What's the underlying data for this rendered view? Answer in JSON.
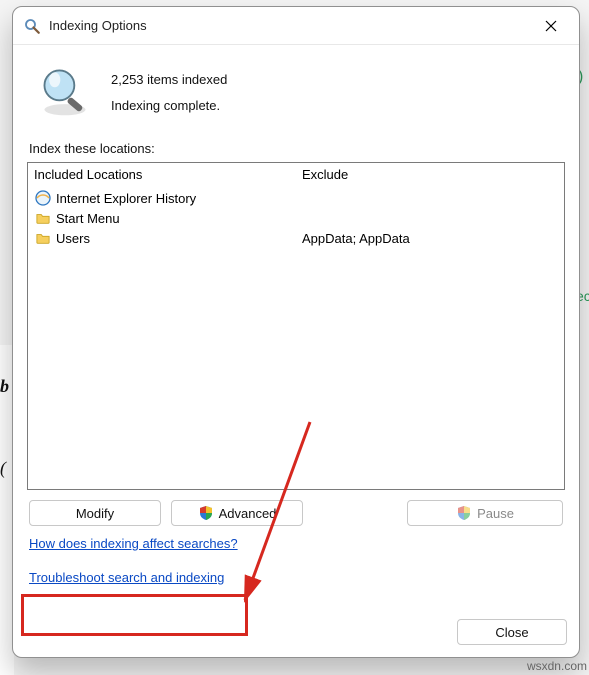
{
  "dialog": {
    "title": "Indexing Options",
    "items_status": "2,253 items indexed",
    "completion_status": "Indexing complete.",
    "locations_label": "Index these locations:",
    "columns": {
      "included": "Included Locations",
      "exclude": "Exclude"
    },
    "rows": [
      {
        "icon": "ie",
        "name": "Internet Explorer History",
        "exclude": ""
      },
      {
        "icon": "folder",
        "name": "Start Menu",
        "exclude": ""
      },
      {
        "icon": "folder",
        "name": "Users",
        "exclude": "AppData; AppData"
      }
    ],
    "buttons": {
      "modify": "Modify",
      "advanced": "Advanced",
      "pause": "Pause",
      "close": "Close"
    },
    "links": {
      "how": "How does indexing affect searches?",
      "troubleshoot": "Troubleshoot search and indexing"
    }
  },
  "watermark": "wsxdn.com"
}
